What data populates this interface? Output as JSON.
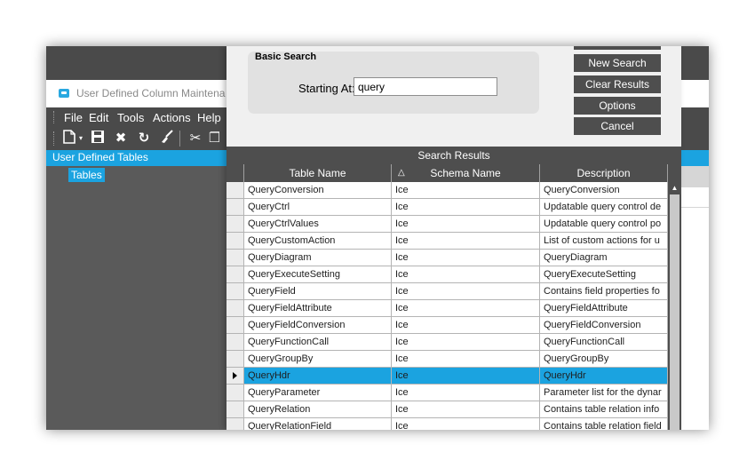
{
  "app": {
    "window_title": "User Defined Column Maintena",
    "menu": [
      "File",
      "Edit",
      "Tools",
      "Actions",
      "Help"
    ],
    "toolbar_icons": [
      "new-icon",
      "dropdown-icon",
      "save-icon",
      "delete-icon",
      "refresh-icon",
      "clear-icon",
      "cut-icon",
      "copy-icon"
    ],
    "tree_header": "User Defined Tables",
    "tree_items": [
      "Tables"
    ]
  },
  "dialog": {
    "basic_search_title": "Basic Search",
    "starting_at_label": "Starting At:",
    "starting_at_value": "query",
    "buttons": {
      "new_search": "New Search",
      "clear_results": "Clear Results",
      "options": "Options",
      "cancel": "Cancel"
    },
    "results_title": "Search Results",
    "columns": [
      "Table Name",
      "Schema Name",
      "Description"
    ],
    "sort": {
      "column": "Table Name",
      "direction": "ascending"
    },
    "selected_row": 11,
    "rows": [
      {
        "table": "QueryConversion",
        "schema": "Ice",
        "description": "QueryConversion"
      },
      {
        "table": "QueryCtrl",
        "schema": "Ice",
        "description": "Updatable query control de"
      },
      {
        "table": "QueryCtrlValues",
        "schema": "Ice",
        "description": "Updatable query control po"
      },
      {
        "table": "QueryCustomAction",
        "schema": "Ice",
        "description": "List of custom actions for u"
      },
      {
        "table": "QueryDiagram",
        "schema": "Ice",
        "description": "QueryDiagram"
      },
      {
        "table": "QueryExecuteSetting",
        "schema": "Ice",
        "description": "QueryExecuteSetting"
      },
      {
        "table": "QueryField",
        "schema": "Ice",
        "description": "Contains field properties fo"
      },
      {
        "table": "QueryFieldAttribute",
        "schema": "Ice",
        "description": "QueryFieldAttribute"
      },
      {
        "table": "QueryFieldConversion",
        "schema": "Ice",
        "description": "QueryFieldConversion"
      },
      {
        "table": "QueryFunctionCall",
        "schema": "Ice",
        "description": "QueryFunctionCall"
      },
      {
        "table": "QueryGroupBy",
        "schema": "Ice",
        "description": "QueryGroupBy"
      },
      {
        "table": "QueryHdr",
        "schema": "Ice",
        "description": "QueryHdr"
      },
      {
        "table": "QueryParameter",
        "schema": "Ice",
        "description": "Parameter list for the dynar"
      },
      {
        "table": "QueryRelation",
        "schema": "Ice",
        "description": "Contains table relation info"
      },
      {
        "table": "QueryRelationField",
        "schema": "Ice",
        "description": "Contains table relation field"
      }
    ]
  },
  "colors": {
    "accent": "#1ba3e0",
    "dark_panel": "#4e4e4e",
    "app_background": "#5a5a5a",
    "dialog_background": "#f0f0f0"
  }
}
